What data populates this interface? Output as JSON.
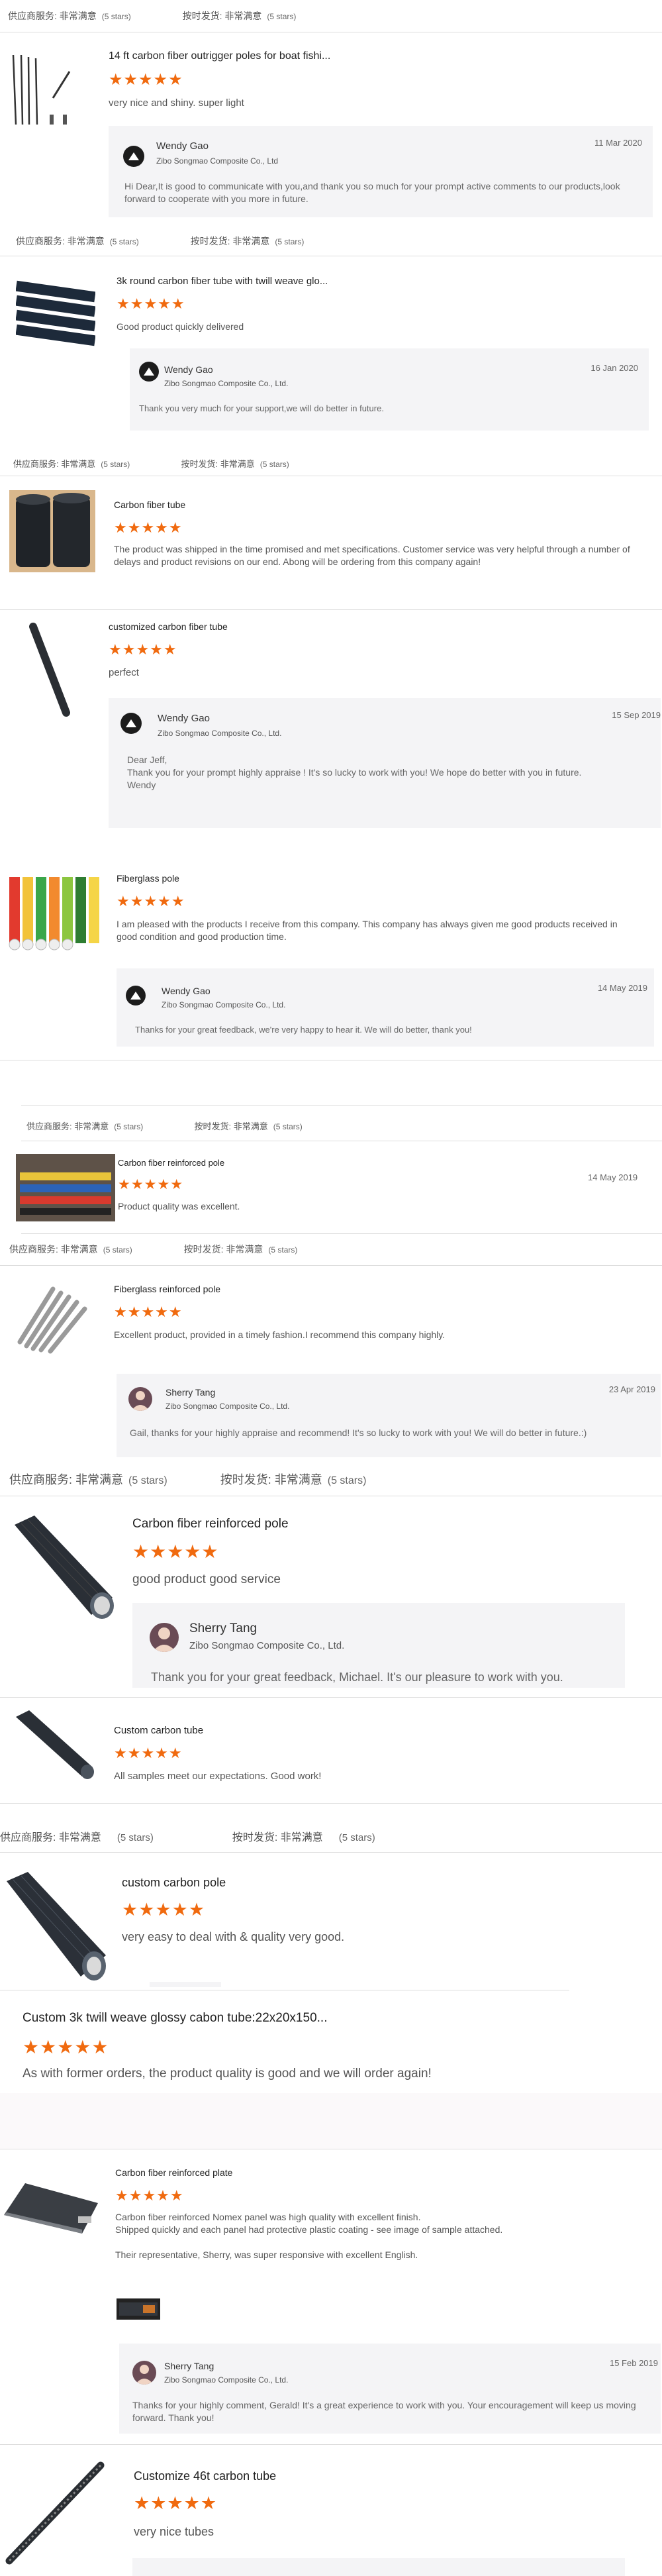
{
  "labels": {
    "supplier_service": "供应商服务: 非常满意",
    "on_time": "按时发货: 非常满意",
    "five_stars": "(5 stars)",
    "stars": "★★★★★"
  },
  "reviews": [
    {
      "title": "14 ft carbon fiber outrigger poles for boat fishi...",
      "comment": "very nice and shiny. super light",
      "reply_name": "Wendy Gao",
      "reply_company": "Zibo Songmao Composite Co., Ltd",
      "reply_date": "11 Mar 2020",
      "reply_text": "Hi Dear,It is good to communicate with you,and thank you so much for your prompt active comments to our products,look forward to cooperate with you more in future."
    },
    {
      "title": "3k round carbon fiber tube with twill weave glo...",
      "comment": "Good product quickly delivered",
      "reply_name": "Wendy Gao",
      "reply_company": "Zibo Songmao Composite Co., Ltd.",
      "reply_date": "16 Jan 2020",
      "reply_text": "Thank you very much for your support,we will do better in future."
    },
    {
      "title": "Carbon fiber tube",
      "comment": "The product was shipped in the time promised and met specifications. Customer service was very helpful through a number of delays and product revisions on our end. Abong will be ordering from this company again!"
    },
    {
      "title": "customized carbon fiber tube",
      "comment": "perfect",
      "reply_name": "Wendy Gao",
      "reply_company": "Zibo Songmao Composite Co., Ltd.",
      "reply_date": "15 Sep 2019",
      "reply_text": "Dear Jeff,\nThank you for your prompt highly appraise ! It's so lucky to work with you! We hope do better with you in future.\nWendy"
    },
    {
      "title": "Fiberglass pole",
      "comment": "I am pleased with the products I receive from this company. This company has always given me good products received in good condition and good production time.",
      "reply_name": "Wendy Gao",
      "reply_company": "Zibo Songmao Composite Co., Ltd.",
      "reply_date": "14 May 2019",
      "reply_text": "Thanks for your great feedback, we're very happy to hear it. We will do better, thank you!"
    },
    {
      "title": "Carbon fiber reinforced pole",
      "comment": "Product quality was excellent.",
      "date": "14 May 2019"
    },
    {
      "title": "Fiberglass reinforced pole",
      "comment": "Excellent product, provided in a timely fashion.I recommend this company highly.",
      "reply_name": "Sherry Tang",
      "reply_company": "Zibo Songmao Composite Co., Ltd.",
      "reply_date": "23 Apr 2019",
      "reply_text": "Gail, thanks for your highly appraise and recommend! It's so lucky to work with you! We will do better in future.:)"
    },
    {
      "title": "Carbon fiber reinforced pole",
      "comment": "good product good service",
      "reply_name": "Sherry Tang",
      "reply_company": "Zibo Songmao Composite Co., Ltd.",
      "reply_text": "Thank you for your great feedback, Michael. It's our pleasure to work with you."
    },
    {
      "title": "Custom carbon tube",
      "comment": "All samples meet our expectations. Good work!"
    },
    {
      "title": "custom carbon pole",
      "comment": "very easy to deal with & quality very good."
    },
    {
      "title": "Custom 3k twill weave glossy cabon tube:22x20x150...",
      "comment": "As with former orders, the product quality is good and we will order again!"
    },
    {
      "title": "Carbon fiber reinforced plate",
      "comment": "Carbon fiber reinforced Nomex panel was high quality with excellent finish.\nShipped quickly and each panel had protective plastic coating - see image of sample attached.\n\nTheir representative, Sherry, was super responsive with excellent English.",
      "reply_name": "Sherry Tang",
      "reply_company": "Zibo Songmao Composite Co., Ltd.",
      "reply_date": "15 Feb 2019",
      "reply_text": "Thanks for your highly comment, Gerald! It's a great experience to work with you. Your encouragement will keep us moving forward. Thank you!"
    },
    {
      "title": "Customize 46t carbon tube",
      "comment": "very nice tubes"
    }
  ]
}
